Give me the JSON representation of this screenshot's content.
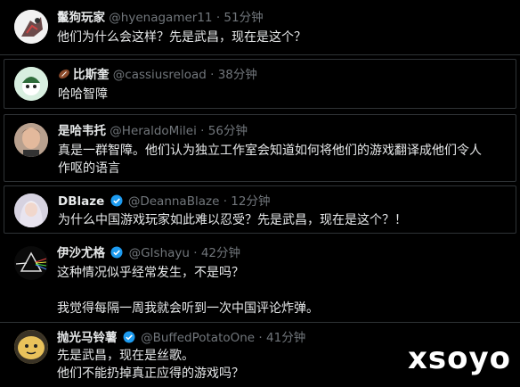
{
  "tweets": [
    {
      "name": "鬣狗玩家",
      "handle": "@hyenagamer11",
      "dot": "·",
      "time": "51分钟",
      "verified": false,
      "lines": [
        "他们为什么会这样？先是武昌，现在是这个？"
      ]
    },
    {
      "name": "比斯奎",
      "handle": "@cassiusreload",
      "dot": "·",
      "time": "38分钟",
      "verified": false,
      "emoji": "football-icon",
      "lines": [
        "哈哈智障"
      ]
    },
    {
      "name": "是哈韦托",
      "handle": "@HeraldoMilei",
      "dot": "·",
      "time": "56分钟",
      "verified": false,
      "lines": [
        "真是一群智障。他们认为独立工作室会知道如何将他们的游戏翻译成他们令人",
        "作呕的语言"
      ]
    },
    {
      "name": "DBlaze",
      "handle": "@DeannaBlaze",
      "dot": "·",
      "time": "12分钟",
      "verified": true,
      "lines": [
        "为什么中国游戏玩家如此难以忍受？先是武昌，现在是这个？！"
      ]
    },
    {
      "name": "伊沙尤格",
      "handle": "@GIshayu",
      "dot": "·",
      "time": "42分钟",
      "verified": true,
      "lines": [
        "这种情况似乎经常发生，不是吗？",
        "",
        "我觉得每隔一周我就会听到一次中国评论炸弹。"
      ]
    },
    {
      "name": "抛光马铃薯",
      "handle": "@BuffedPotatoOne",
      "dot": "·",
      "time": "41分钟",
      "verified": true,
      "lines": [
        "先是武昌，现在是丝歌。",
        "他们不能扔掉真正应得的游戏吗？"
      ]
    }
  ],
  "watermark": "xsoyo",
  "colors": {
    "background": "#000000",
    "text": "#e7e9ea",
    "muted": "#71767b",
    "border": "#2f3336",
    "verified": "#1d9bf0"
  }
}
